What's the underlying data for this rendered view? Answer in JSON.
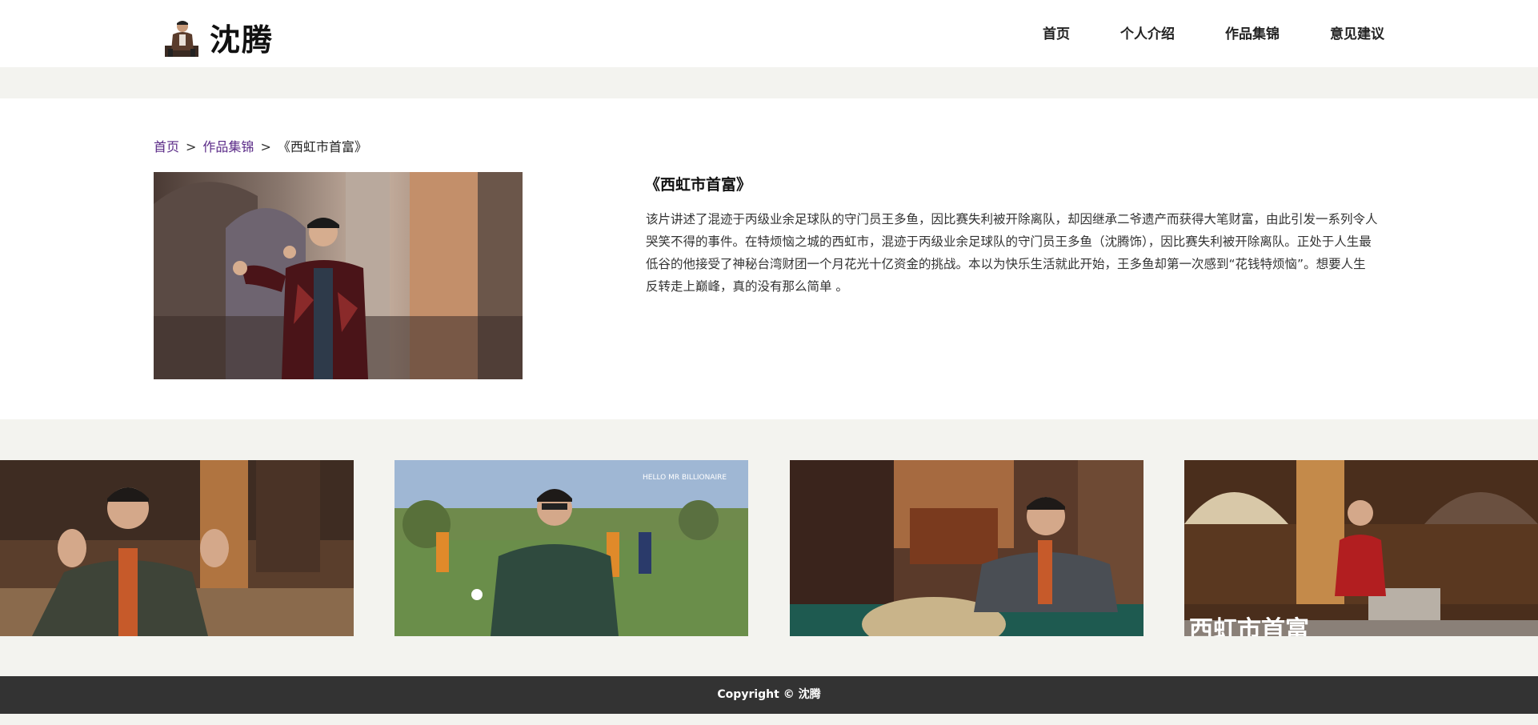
{
  "header": {
    "logo_text": "沈腾",
    "nav": [
      {
        "label": "首页"
      },
      {
        "label": "个人介绍"
      },
      {
        "label": "作品集锦"
      },
      {
        "label": "意见建议"
      }
    ]
  },
  "breadcrumb": {
    "home": "首页",
    "works": "作品集锦",
    "separator": ">",
    "current": "《西虹市首富》"
  },
  "work": {
    "title": "《西虹市首富》",
    "description": "该片讲述了混迹于丙级业余足球队的守门员王多鱼，因比赛失利被开除离队，却因继承二爷遗产而获得大笔财富，由此引发一系列令人哭笑不得的事件。在特烦恼之城的西虹市，混迹于丙级业余足球队的守门员王多鱼（沈腾饰），因比赛失利被开除离队。正处于人生最低谷的他接受了神秘台湾财团一个月花光十亿资金的挑战。本以为快乐生活就此开始，王多鱼却第一次感到“花钱特烦恼”。想要人生反转走上巅峰，真的没有那么简单 。"
  },
  "gallery": {
    "thumb2_caption": "HELLO MR BILLIONAIRE",
    "thumb4_caption": "西虹市首富"
  },
  "footer": {
    "copyright": "Copyright © 沈腾"
  },
  "colors": {
    "page_bg": "#f3f3ef",
    "footer_bg": "#333333",
    "link": "#5a2a87"
  }
}
